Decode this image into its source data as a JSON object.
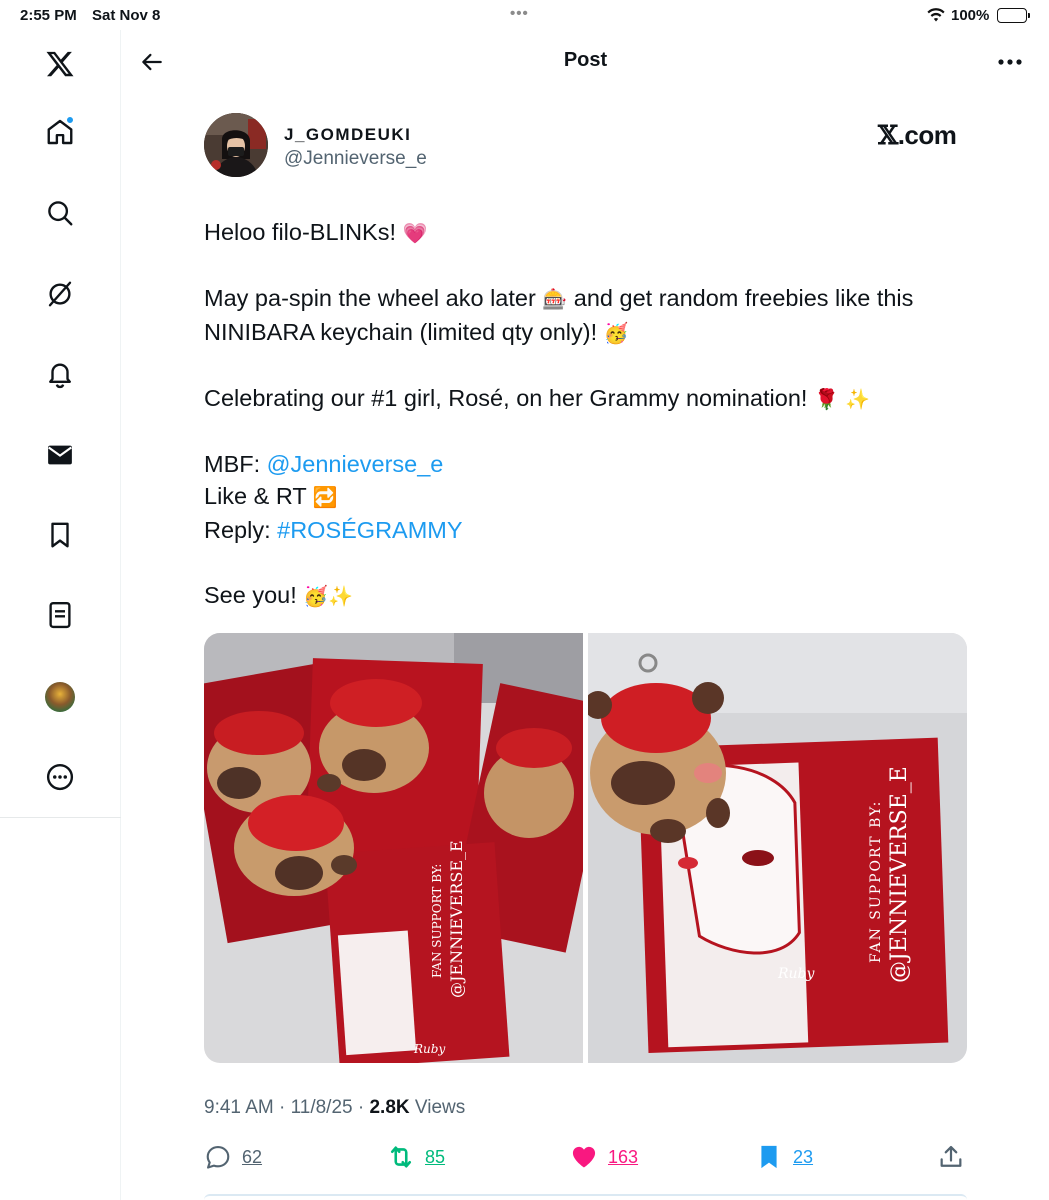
{
  "status_bar": {
    "time": "2:55 PM",
    "date": "Sat Nov 8",
    "battery": "100%",
    "battery_level": 1.0
  },
  "sidebar": {
    "items": [
      {
        "name": "x-logo-icon"
      },
      {
        "name": "home-icon",
        "has_notification_dot": true
      },
      {
        "name": "search-icon"
      },
      {
        "name": "grok-icon"
      },
      {
        "name": "bell-icon"
      },
      {
        "name": "mail-icon"
      },
      {
        "name": "bookmark-icon"
      },
      {
        "name": "lists-icon"
      },
      {
        "name": "profile-avatar"
      },
      {
        "name": "more-circle-icon"
      }
    ]
  },
  "header": {
    "title": "Post",
    "back_icon": "arrow-left-icon",
    "more_icon": "more-horizontal-icon"
  },
  "tweet": {
    "author_name": "J_GOMDEUKI",
    "author_handle": "@Jennieverse_e",
    "source": ".com",
    "source_prefix": "𝕏",
    "text": {
      "line1": "Heloo filo-BLINKs! ",
      "line2a": "May pa-spin the wheel ako later ",
      "line2b": " and get random freebies like this",
      "line3": "NINIBARA keychain (limited qty only)! ",
      "line4": "Celebrating our #1 girl, Rosé, on her Grammy nomination! ",
      "mbf_label": "MBF: ",
      "mbf_link": "@Jennieverse_e",
      "like_rt": "Like & RT ",
      "reply_label": "Reply: ",
      "reply_tag": "#ROSÉGRAMMY",
      "see_you": "See you! "
    },
    "emoji": {
      "heart": "💗",
      "slot": "🎰",
      "party": "🥳",
      "rose": "🌹",
      "sparkles": "✨",
      "repeat": "🔁"
    },
    "media_texts": {
      "left_card": "FAN SUPPORT BY:",
      "left_card_handle": "@JENNIEVERSE_E",
      "right_card": "FAN SUPPORT BY:",
      "right_card_handle": "@JENNIEVERSE_E",
      "signature": "Ruby"
    },
    "time": "9:41 AM · 11/8/25 · ",
    "views_count": "2.8K",
    "views_label": " Views",
    "counts": {
      "replies": "62",
      "reposts": "85",
      "likes": "163",
      "bookmarks": "23"
    }
  },
  "colors": {
    "accent": "#1d9bf0",
    "repost": "#00ba7c",
    "like": "#f91880",
    "text": "#0f1419",
    "secondary": "#536471"
  }
}
